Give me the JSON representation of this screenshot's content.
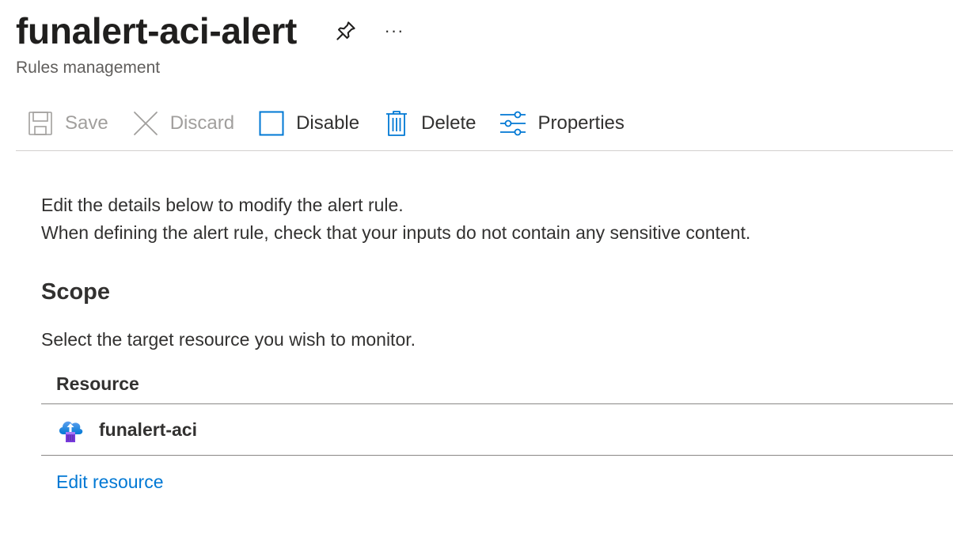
{
  "header": {
    "title": "funalert-aci-alert",
    "subtitle": "Rules management",
    "pin_icon": "pin-icon",
    "more_label": "···"
  },
  "toolbar": {
    "save": {
      "label": "Save",
      "icon": "save-icon",
      "enabled": false
    },
    "discard": {
      "label": "Discard",
      "icon": "close-icon",
      "enabled": false
    },
    "disable": {
      "label": "Disable",
      "icon": "checkbox-icon",
      "enabled": true
    },
    "delete": {
      "label": "Delete",
      "icon": "trash-icon",
      "enabled": true
    },
    "properties": {
      "label": "Properties",
      "icon": "sliders-icon",
      "enabled": true
    }
  },
  "intro": {
    "line1": "Edit the details below to modify the alert rule.",
    "line2": "When defining the alert rule, check that your inputs do not contain any sensitive content."
  },
  "scope": {
    "title": "Scope",
    "description": "Select the target resource you wish to monitor.",
    "table": {
      "column_header": "Resource",
      "rows": [
        {
          "name": "funalert-aci",
          "icon": "container-instance-icon"
        }
      ]
    },
    "edit_link": "Edit resource"
  },
  "colors": {
    "accent": "#0078d4",
    "text": "#323130",
    "disabled": "#a19f9d",
    "divider": "#d2d0ce"
  }
}
